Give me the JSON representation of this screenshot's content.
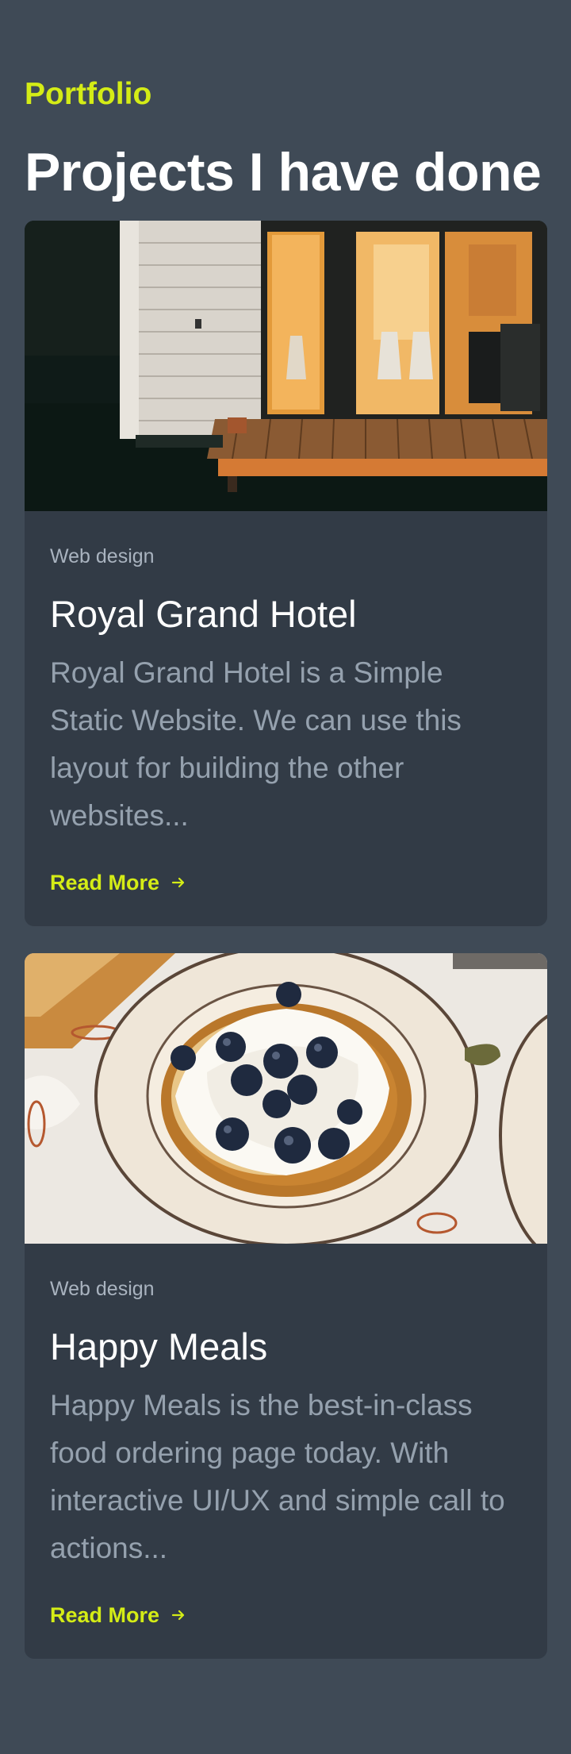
{
  "header": {
    "eyebrow": "Portfolio",
    "title": "Projects I have done"
  },
  "colors": {
    "background": "#3f4a56",
    "card": "#323b46",
    "accent": "#d4ec16",
    "title_text": "#ffffff",
    "muted_text": "#95a1ae"
  },
  "projects": [
    {
      "category": "Web design",
      "title": "Royal Grand Hotel",
      "description": "Royal Grand Hotel is a Simple Static Website. We can use this layout for building the other websites...",
      "link_label": "Read More",
      "link_icon": "arrow-right-icon",
      "image": "tiny-house-at-night-photo"
    },
    {
      "category": "Web design",
      "title": "Happy Meals",
      "description": "Happy Meals is the best-in-class food ordering page today. With interactive UI/UX and simple call to actions...",
      "link_label": "Read More",
      "link_icon": "arrow-right-icon",
      "image": "blueberry-pancakes-photo"
    }
  ]
}
